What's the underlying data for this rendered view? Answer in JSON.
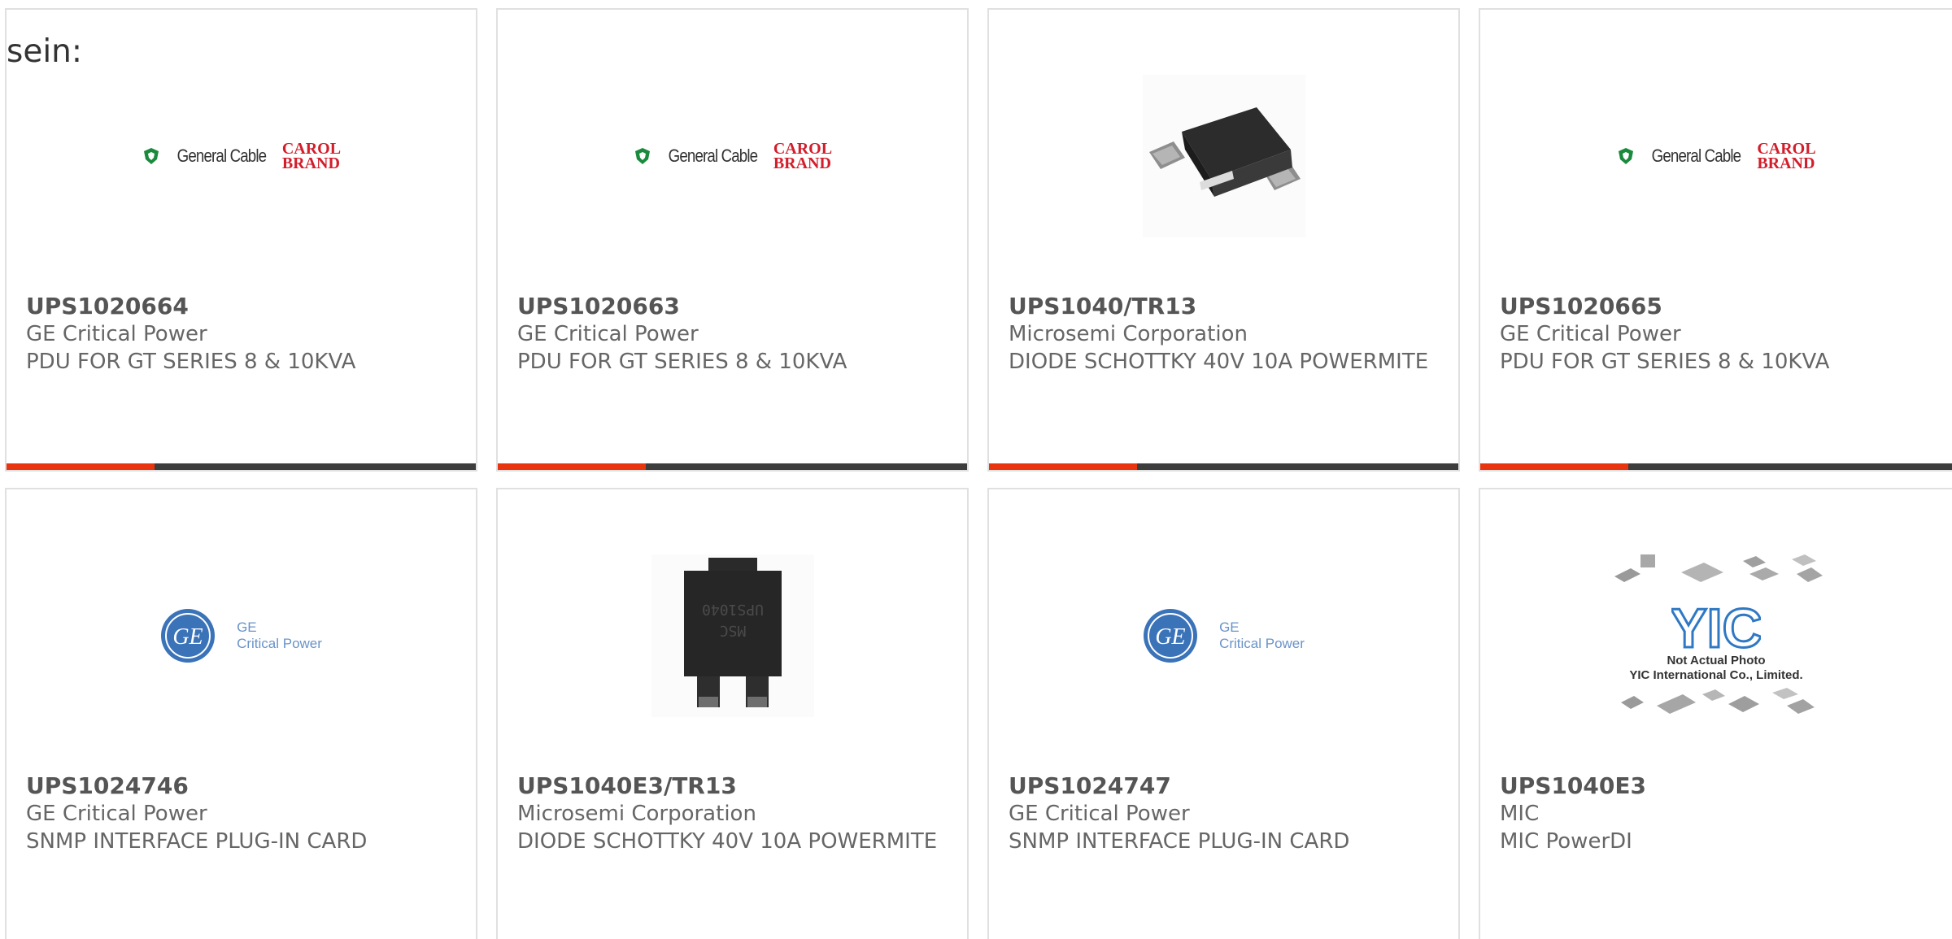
{
  "intro": "sein:",
  "colors": {
    "accent": "#e8340f",
    "bar": "#3d3d3d",
    "text": "#666666",
    "border": "#e0e0e0"
  },
  "products": [
    {
      "part": "UPS1020664",
      "maker": "GE Critical Power",
      "desc": "PDU FOR GT SERIES 8 & 10KVA",
      "image": "general-cable-carol-brand-logo",
      "logo": {
        "left": "General Cable",
        "right_top": "CAROL",
        "right_bottom": "BRAND"
      }
    },
    {
      "part": "UPS1020663",
      "maker": "GE Critical Power",
      "desc": "PDU FOR GT SERIES 8 & 10KVA",
      "image": "general-cable-carol-brand-logo",
      "logo": {
        "left": "General Cable",
        "right_top": "CAROL",
        "right_bottom": "BRAND"
      }
    },
    {
      "part": "UPS1040/TR13",
      "maker": "Microsemi Corporation",
      "desc": "DIODE SCHOTTKY 40V 10A POWERMITE",
      "image": "powermite-diode-photo"
    },
    {
      "part": "UPS1020665",
      "maker": "GE Critical Power",
      "desc": "PDU FOR GT SERIES 8 & 10KVA",
      "image": "general-cable-carol-brand-logo",
      "logo": {
        "left": "General Cable",
        "right_top": "CAROL",
        "right_bottom": "BRAND"
      }
    },
    {
      "part": "UPS1024746",
      "maker": "GE Critical Power",
      "desc": "SNMP INTERFACE PLUG-IN CARD",
      "image": "ge-critical-power-logo",
      "logo": {
        "line1": "GE",
        "line2": "Critical Power"
      }
    },
    {
      "part": "UPS1040E3/TR13",
      "maker": "Microsemi Corporation",
      "desc": "DIODE SCHOTTKY 40V 10A POWERMITE",
      "image": "powermite-diode-marked-photo"
    },
    {
      "part": "UPS1024747",
      "maker": "GE Critical Power",
      "desc": "SNMP INTERFACE PLUG-IN CARD",
      "image": "ge-critical-power-logo",
      "logo": {
        "line1": "GE",
        "line2": "Critical Power"
      }
    },
    {
      "part": "UPS1040E3",
      "maker": "MIC",
      "desc": "MIC PowerDI",
      "image": "yic-not-actual-photo",
      "caption": {
        "line1": "Not Actual Photo",
        "line2": "YIC International Co., Limited."
      }
    }
  ]
}
